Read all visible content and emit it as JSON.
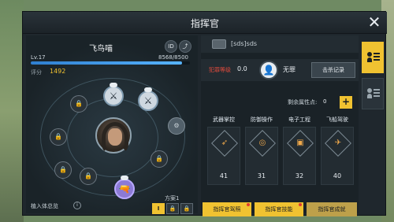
{
  "title": "指挥官",
  "close_glyph": "✕",
  "player": {
    "name": "飞鸟喵",
    "id_btn": "ID",
    "share_icon": "share-icon",
    "level": "Lv.17",
    "exp_text": "8568/8500",
    "exp_fraction": 0.95,
    "score_label": "评分",
    "score_value": "1492"
  },
  "skill_tree": {
    "lock_glyph": "🔒",
    "nodes_icon": "lock-icon",
    "skill_glyphs": [
      "⚔",
      "⚔",
      "⚙",
      "🔫"
    ]
  },
  "implant": {
    "label": "植入体总览",
    "info_glyph": "i"
  },
  "plan": {
    "label": "方案1",
    "slots": [
      "I",
      "🔒",
      "🔒"
    ]
  },
  "guild": {
    "tag": "[sds]sds"
  },
  "crime": {
    "label": "犯罪等级",
    "value": "0.0",
    "status": "无罪",
    "kill_record": "击杀记录"
  },
  "attributes": {
    "remain_label": "剩余属性点:",
    "remain_value": "0",
    "plus": "+",
    "items": [
      {
        "label": "武器掌控",
        "value": "41",
        "icon": "weapon-icon"
      },
      {
        "label": "防御操作",
        "value": "31",
        "icon": "defense-icon"
      },
      {
        "label": "电子工程",
        "value": "32",
        "icon": "electronics-icon"
      },
      {
        "label": "飞船驾驶",
        "value": "40",
        "icon": "pilot-icon"
      }
    ]
  },
  "buttons": {
    "license": "指挥官驾照",
    "skills": "指挥官技能",
    "achievements": "指挥官成就"
  },
  "colors": {
    "accent": "#f0c231",
    "danger": "#e24a3c",
    "exp": "#3a93e6"
  }
}
